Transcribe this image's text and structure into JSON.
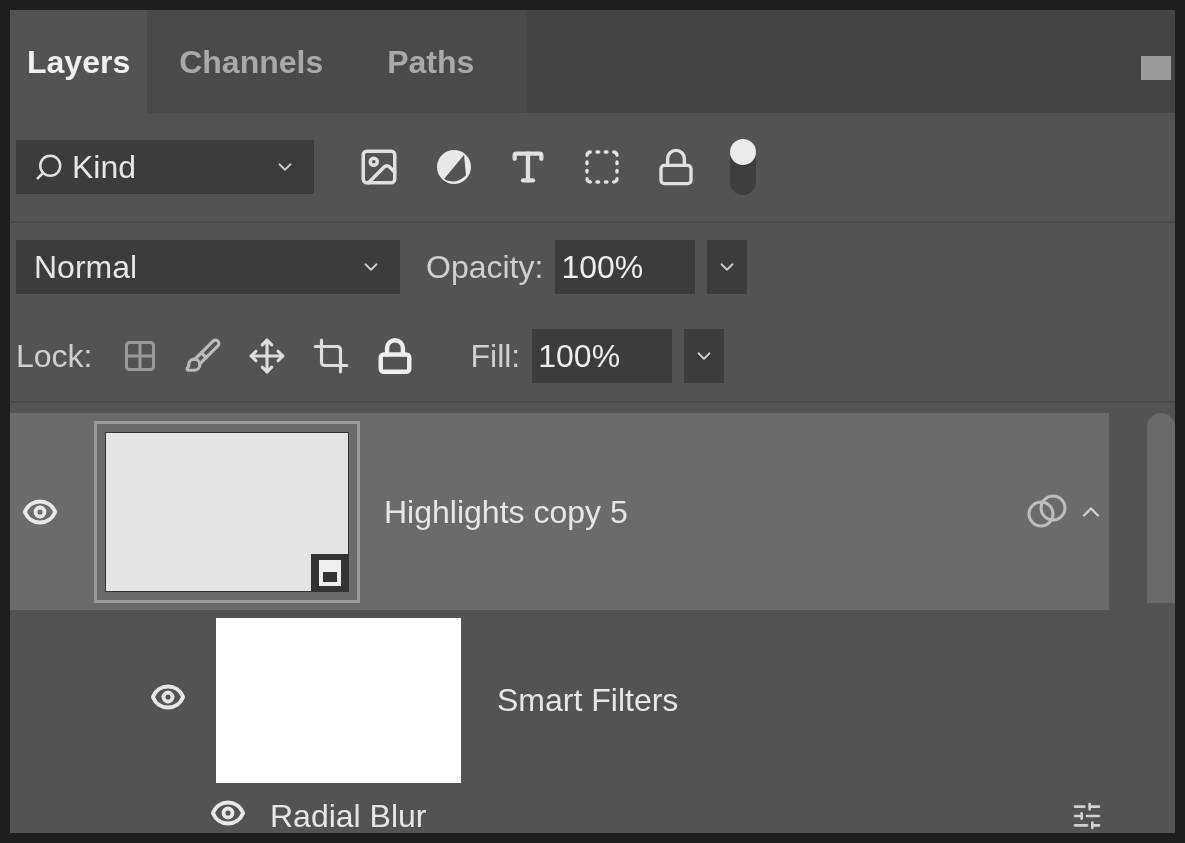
{
  "tabs": [
    {
      "label": "Layers",
      "selected": true
    },
    {
      "label": "Channels",
      "selected": false
    },
    {
      "label": "Paths",
      "selected": false
    }
  ],
  "filter": {
    "value": "Kind",
    "on": true
  },
  "blend": {
    "value": "Normal",
    "opacity_label": "Opacity:",
    "opacity": "100%"
  },
  "lock": {
    "label": "Lock:",
    "fill_label": "Fill:",
    "fill": "100%"
  },
  "layers": [
    {
      "name": "Highlights copy 5",
      "selected": true,
      "visible": true,
      "kind": "smart",
      "children": [
        {
          "name": "Smart Filters",
          "visible": true,
          "kind": "mask",
          "children": [
            {
              "name": "Radial Blur",
              "visible": true,
              "kind": "filter"
            }
          ]
        }
      ]
    }
  ]
}
